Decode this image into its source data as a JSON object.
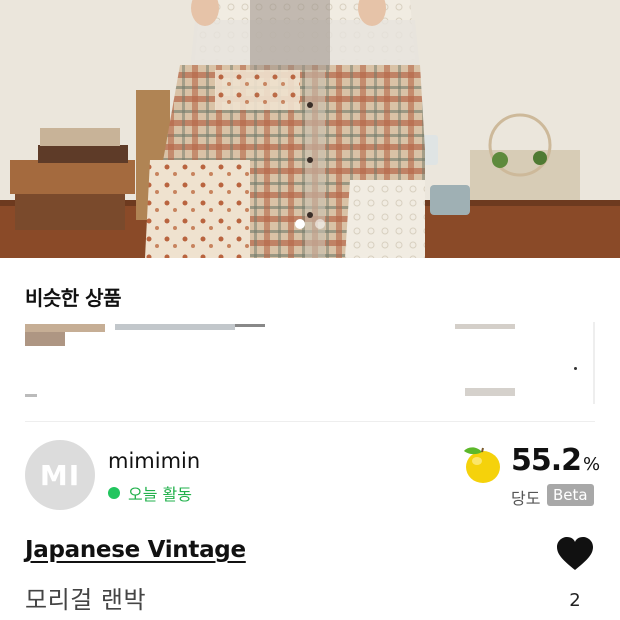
{
  "hero": {
    "carousel": {
      "total": 2,
      "active_index": 0
    }
  },
  "similar": {
    "title": "비슷한 상품"
  },
  "seller": {
    "avatar_initials": "MI",
    "name": "mimimin",
    "activity": "오늘 활동"
  },
  "sweetness": {
    "icon": "yellow-apple-icon",
    "value": "55.2",
    "unit": "%",
    "label": "당도",
    "badge": "Beta"
  },
  "product": {
    "category": "Japanese Vintage",
    "name": "모리걸 랜박"
  },
  "like": {
    "icon": "heart-icon",
    "count": "2"
  },
  "colors": {
    "accent_green": "#22c55e",
    "badge_gray": "#a8a8a8",
    "fruit_yellow": "#f5d20b"
  }
}
